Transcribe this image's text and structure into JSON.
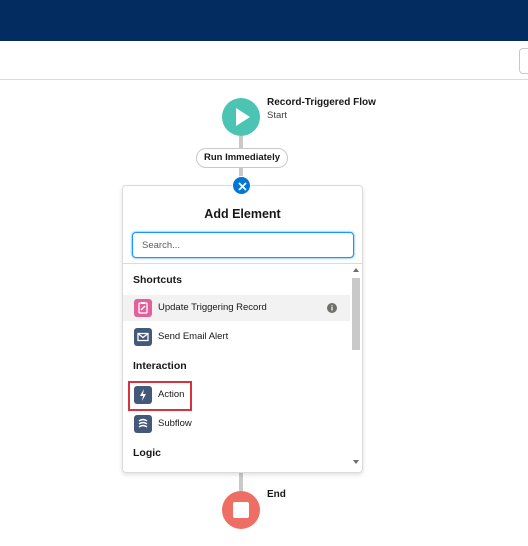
{
  "colors": {
    "header": "#032d60",
    "start_node": "#4bc4b4",
    "end_node": "#ef6e64",
    "accent": "#0176d3",
    "highlight_outline": "#d8323c"
  },
  "start": {
    "title": "Record-Triggered Flow",
    "subtitle": "Start",
    "icon": "play-icon"
  },
  "path_label": "Run Immediately",
  "close_icon": "close-icon",
  "panel": {
    "title": "Add Element",
    "search_placeholder": "Search...",
    "sections": [
      {
        "label": "Shortcuts",
        "items": [
          {
            "label": "Update Triggering Record",
            "icon": "update-record-icon",
            "icon_color": "#e2619b",
            "has_info": true
          },
          {
            "label": "Send Email Alert",
            "icon": "email-icon",
            "icon_color": "#44587a"
          }
        ]
      },
      {
        "label": "Interaction",
        "items": [
          {
            "label": "Action",
            "icon": "lightning-icon",
            "icon_color": "#44587a",
            "highlighted": true
          },
          {
            "label": "Subflow",
            "icon": "subflow-icon",
            "icon_color": "#44587a"
          }
        ]
      },
      {
        "label": "Logic",
        "items": []
      }
    ]
  },
  "end": {
    "label": "End",
    "icon": "stop-icon"
  }
}
